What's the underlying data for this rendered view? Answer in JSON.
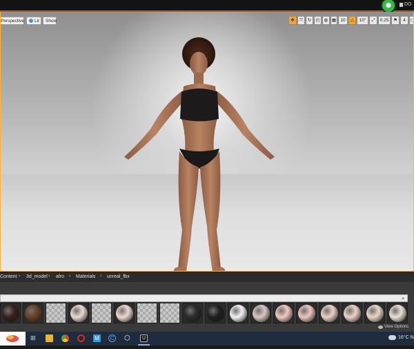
{
  "viewport": {
    "perspective_label": "Perspective",
    "lit_label": "Lit",
    "show_label": "Show",
    "toolbar": {
      "grid_size": "10",
      "rotation_snap": "10°",
      "scale_snap": "0.25",
      "camera_speed": "4"
    }
  },
  "top_bar": {
    "right_text": "DO"
  },
  "content_browser": {
    "breadcrumbs": [
      "Content",
      "3d_model",
      "afro",
      "Materials",
      "unreal_fbx"
    ],
    "view_options_label": "View Options",
    "thumbnails": [
      {
        "kind": "ball",
        "color": "#3a2318"
      },
      {
        "kind": "ball",
        "color": "#6b4127"
      },
      {
        "kind": "checker"
      },
      {
        "kind": "ball",
        "color": "#e9dad0"
      },
      {
        "kind": "checker"
      },
      {
        "kind": "ball",
        "color": "#ecd8cc"
      },
      {
        "kind": "checker"
      },
      {
        "kind": "checker"
      },
      {
        "kind": "ball",
        "color": "#2a2a2a"
      },
      {
        "kind": "ball",
        "color": "#1f1f1f"
      },
      {
        "kind": "ball",
        "color": "#f2f2f2"
      },
      {
        "kind": "ball",
        "color": "#d9c7c0"
      },
      {
        "kind": "ball",
        "color": "#f1c9c0"
      },
      {
        "kind": "ball",
        "color": "#eec6bd"
      },
      {
        "kind": "ball",
        "color": "#efd0c7"
      },
      {
        "kind": "ball",
        "color": "#f0d2c6"
      },
      {
        "kind": "ball",
        "color": "#ead8c8"
      },
      {
        "kind": "ball",
        "color": "#eae0d4"
      }
    ]
  },
  "taskbar": {
    "temperature": "16°C  N"
  },
  "colors": {
    "accent": "#f0a73a",
    "start_logo": "#e0322a"
  }
}
